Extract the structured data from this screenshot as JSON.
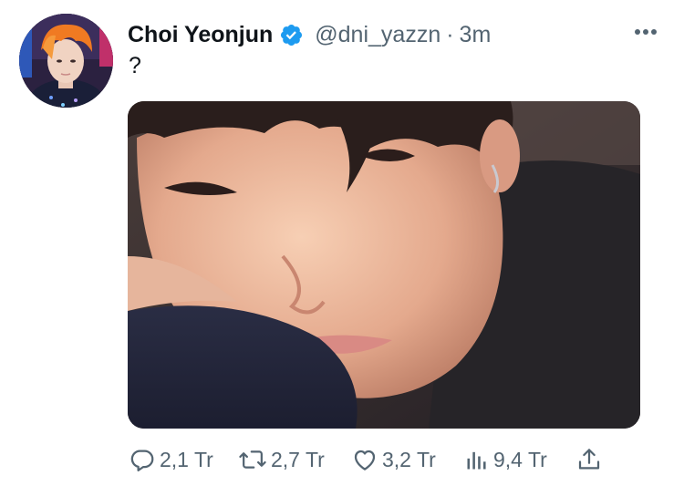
{
  "tweet": {
    "author": {
      "display_name": "Choi Yeonjun",
      "handle": "@dni_yazzn",
      "verified": true
    },
    "separator": "·",
    "timestamp": "3m",
    "text": "?",
    "media": {
      "type": "photo"
    },
    "more_icon": "more-dots-icon",
    "actions": {
      "reply": {
        "icon": "reply-icon",
        "count": "2,1 Tr"
      },
      "retweet": {
        "icon": "retweet-icon",
        "count": "2,7 Tr"
      },
      "like": {
        "icon": "heart-icon",
        "count": "3,2 Tr"
      },
      "views": {
        "icon": "views-icon",
        "count": "9,4 Tr"
      },
      "share": {
        "icon": "share-icon"
      }
    }
  },
  "colors": {
    "text_primary": "#0f1419",
    "text_secondary": "#536471",
    "verified_blue": "#1d9bf0",
    "background": "#ffffff"
  }
}
